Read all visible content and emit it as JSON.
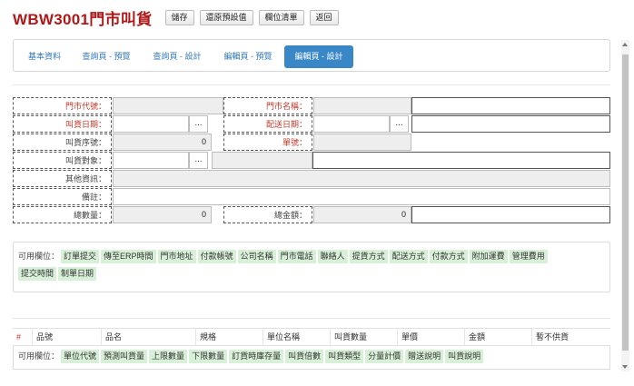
{
  "header": {
    "title": "WBW3001門市叫貨",
    "buttons": [
      "儲存",
      "還原預設值",
      "欄位清單",
      "返回"
    ]
  },
  "tabs": [
    {
      "label": "基本資料"
    },
    {
      "label": "查詢頁 - 預覽"
    },
    {
      "label": "查詢頁 - 設計"
    },
    {
      "label": "編輯頁 - 預覽"
    },
    {
      "label": "編輯頁 - 設計"
    }
  ],
  "active_tab": "編輯頁 - 設計",
  "form": {
    "store_code_label": "門市代號：",
    "store_name_label": "門市名稱：",
    "order_date_label": "叫貨日期：",
    "delivery_date_label": "配送日期：",
    "order_seq_label": "叫貨序號：",
    "order_seq_value": "0",
    "doc_no_label": "單號：",
    "order_target_label": "叫貨對象：",
    "other_info_label": "其他資訊：",
    "remark_label": "備註：",
    "total_qty_label": "總數量：",
    "total_qty_value": "0",
    "total_amount_label": "總金額：",
    "total_amount_value": "0",
    "picker_glyph": "..."
  },
  "available_fields": {
    "label": "可用欄位：",
    "items": [
      "訂單提交",
      "傳至ERP時間",
      "門市地址",
      "付款帳號",
      "公司名稱",
      "門市電話",
      "聯絡人",
      "提貨方式",
      "配送方式",
      "付款方式",
      "附加運費",
      "管理費用",
      "提交時間",
      "制單日期"
    ]
  },
  "detail": {
    "columns": [
      "#",
      "品號",
      "品名",
      "規格",
      "單位名稱",
      "叫貨數量",
      "單價",
      "金額",
      "暫不供貨"
    ],
    "available_label": "可用欄位：",
    "available_items": [
      "單位代號",
      "預測叫貨量",
      "上限數量",
      "下限數量",
      "訂貨時庫存量",
      "叫貨倍數",
      "叫貨類型",
      "分量計價",
      "贈送說明",
      "叫貨說明"
    ]
  },
  "colors": {
    "title": "#b01818",
    "required_label": "#c0392b",
    "tab_active_bg": "#3a87c8",
    "tab_link": "#337ab7",
    "chip_bg": "#d8f0d8"
  }
}
